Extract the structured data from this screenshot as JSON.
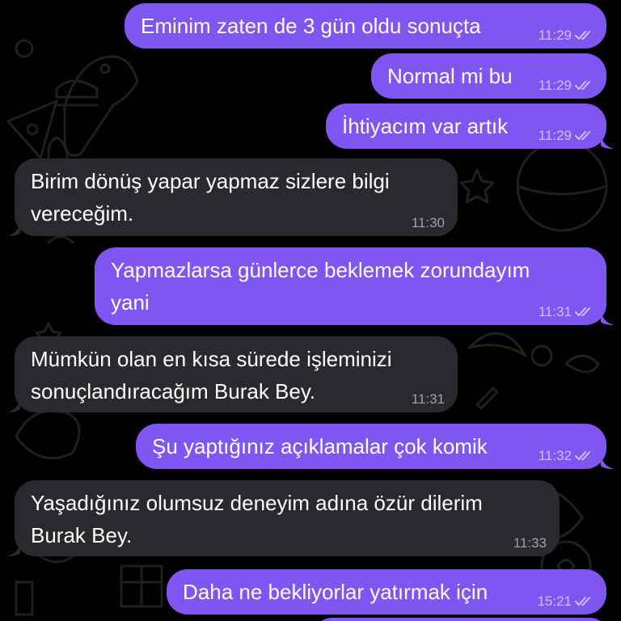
{
  "chat": {
    "messages": [
      {
        "id": "m1",
        "direction": "out",
        "text": "Eminim zaten de 3 gün oldu sonuçta",
        "time": "11:29",
        "read_icon": "double-check-icon"
      },
      {
        "id": "m2",
        "direction": "out",
        "text": "Normal mi bu",
        "time": "11:29",
        "read_icon": "double-check-icon"
      },
      {
        "id": "m3",
        "direction": "out",
        "text": "İhtiyacım var artık",
        "time": "11:29",
        "read_icon": "double-check-icon"
      },
      {
        "id": "m4",
        "direction": "in",
        "line1": "Birim dönüş yapar yapmaz sizlere bilgi",
        "line2": "vereceğim.",
        "time": "11:30"
      },
      {
        "id": "m5",
        "direction": "out",
        "line1": "Yapmazlarsa günlerce beklemek zorundayım",
        "line2": "yani",
        "time": "11:31",
        "read_icon": "double-check-icon"
      },
      {
        "id": "m6",
        "direction": "in",
        "line1": "Mümkün olan en kısa sürede işleminizi",
        "line2": "sonuçlandıracağım Burak Bey.",
        "time": "11:31"
      },
      {
        "id": "m7",
        "direction": "out",
        "text": "Şu yaptığınız açıklamalar çok komik",
        "time": "11:32",
        "read_icon": "double-check-icon"
      },
      {
        "id": "m8",
        "direction": "in",
        "line1": "Yaşadığınız olumsuz deneyim adına özür dilerim",
        "line2": "Burak Bey.",
        "time": "11:33"
      },
      {
        "id": "m9",
        "direction": "out",
        "text": "Daha ne bekliyorlar yatırmak için",
        "time": "15:21",
        "read_icon": "double-check-icon"
      }
    ]
  },
  "colors": {
    "outgoing_bubble": "#7f56f2",
    "incoming_bubble": "#2a2a2e",
    "background": "#000000",
    "doodle": "#1f1f22"
  },
  "wallpaper_icon": "doodle-pattern"
}
